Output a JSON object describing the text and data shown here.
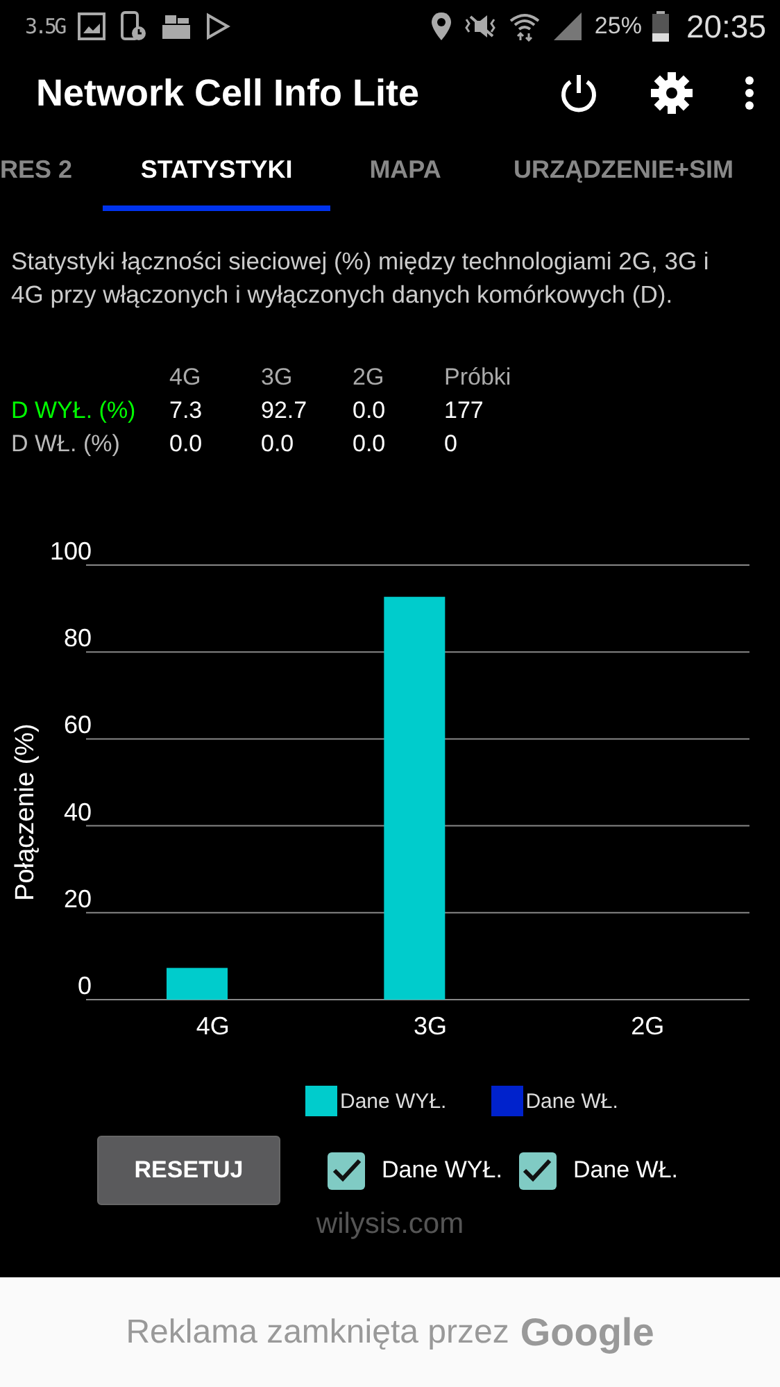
{
  "status_bar": {
    "network_label": "3.5G",
    "battery_percent": "25%",
    "time": "20:35"
  },
  "app_bar": {
    "title": "Network Cell Info Lite"
  },
  "tabs": [
    {
      "label": "RES 2",
      "selected": false
    },
    {
      "label": "STATYSTYKI",
      "selected": true
    },
    {
      "label": "MAPA",
      "selected": false
    },
    {
      "label": "URZĄDZENIE+SIM",
      "selected": false
    }
  ],
  "description": "Statystyki łączności sieciowej (%) między technologiami 2G, 3G i 4G przy włączonych i wyłączonych danych komórkowych (D).",
  "stats_table": {
    "columns": [
      "4G",
      "3G",
      "2G",
      "Próbki"
    ],
    "rows": [
      {
        "label": "D WYŁ. (%)",
        "color": "#00ff00",
        "cells": [
          "7.3",
          "92.7",
          "0.0",
          "177"
        ]
      },
      {
        "label": "D WŁ. (%)",
        "color": "#bbbbbb",
        "cells": [
          "0.0",
          "0.0",
          "0.0",
          "0"
        ]
      }
    ]
  },
  "chart": {
    "chart_data": {
      "type": "bar",
      "ylabel": "Połączenie (%)",
      "categories": [
        "4G",
        "3G",
        "2G"
      ],
      "series": [
        {
          "name": "Dane WYŁ.",
          "color": "#00cccc",
          "values": [
            7.3,
            92.7,
            0.0
          ]
        },
        {
          "name": "Dane WŁ.",
          "color": "#0022cc",
          "values": [
            0.0,
            0.0,
            0.0
          ]
        }
      ],
      "grid": true,
      "ylim": [
        0,
        100
      ],
      "yticks": [
        0,
        20,
        40,
        60,
        80,
        100
      ]
    }
  },
  "controls": {
    "reset_button": "RESETUJ",
    "checkboxes": [
      {
        "label": "Dane WYŁ.",
        "checked": true
      },
      {
        "label": "Dane WŁ.",
        "checked": true
      }
    ]
  },
  "footer_link": "wilysis.com",
  "ad_banner": {
    "text": "Reklama zamknięta przez",
    "brand": "Google"
  }
}
